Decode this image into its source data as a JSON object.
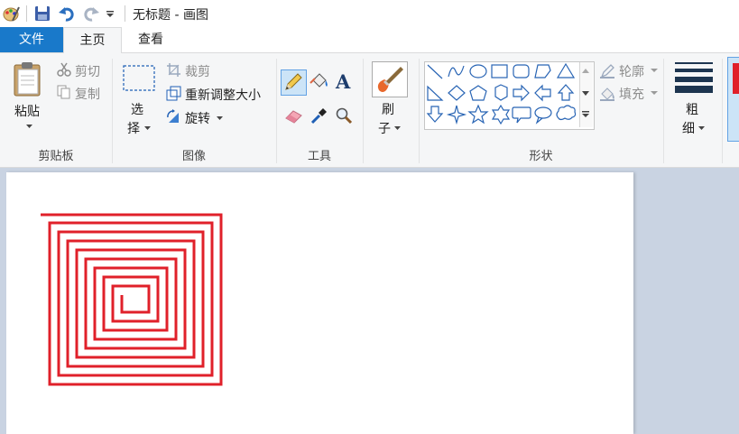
{
  "window": {
    "title": "无标题 - 画图"
  },
  "tabs": {
    "file": "文件",
    "home": "主页",
    "view": "查看"
  },
  "clipboard": {
    "paste": "粘贴",
    "cut": "剪切",
    "copy": "复制",
    "group": "剪贴板"
  },
  "image": {
    "select_1": "选",
    "select_2": "择",
    "crop": "裁剪",
    "resize": "重新调整大小",
    "rotate": "旋转",
    "group": "图像"
  },
  "tools": {
    "group": "工具"
  },
  "brush": {
    "line1": "刷",
    "line2": "子"
  },
  "shapes": {
    "group": "形状",
    "outline": "轮廓",
    "fill": "填充"
  },
  "size": {
    "line1": "粗",
    "line2": "细"
  },
  "colors": {
    "accent": "#1979ca",
    "spiral": "#e0202a"
  }
}
